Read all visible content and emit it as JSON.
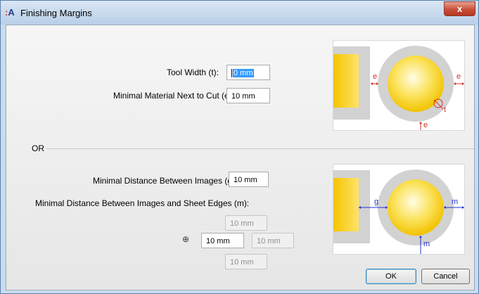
{
  "window": {
    "app_icon": "A",
    "title": "Finishing Margins",
    "close_label": "x"
  },
  "tool_width": {
    "label": "Tool Width (t):",
    "value": "0 mm"
  },
  "min_material": {
    "label": "Minimal Material Next to Cut (e):",
    "value": "10 mm"
  },
  "separator": {
    "label": "OR"
  },
  "min_distance_images": {
    "label": "Minimal Distance Between Images (g):",
    "value": "10 mm"
  },
  "min_distance_edges": {
    "label": "Minimal Distance Between Images and Sheet Edges (m):",
    "top": "10 mm",
    "left": "10 mm",
    "right": "10 mm",
    "bottom": "10 mm",
    "link_icon": "link-icon"
  },
  "diagram_top": {
    "labels": [
      "e",
      "e",
      "t",
      "e"
    ]
  },
  "diagram_bottom": {
    "labels": [
      "g",
      "m",
      "m"
    ]
  },
  "buttons": {
    "ok": "OK",
    "cancel": "Cancel"
  },
  "colors": {
    "label_red": "#d0312d",
    "label_blue": "#2233cc",
    "gold": "#f2c200",
    "ring_gray": "#d0d0d0"
  }
}
